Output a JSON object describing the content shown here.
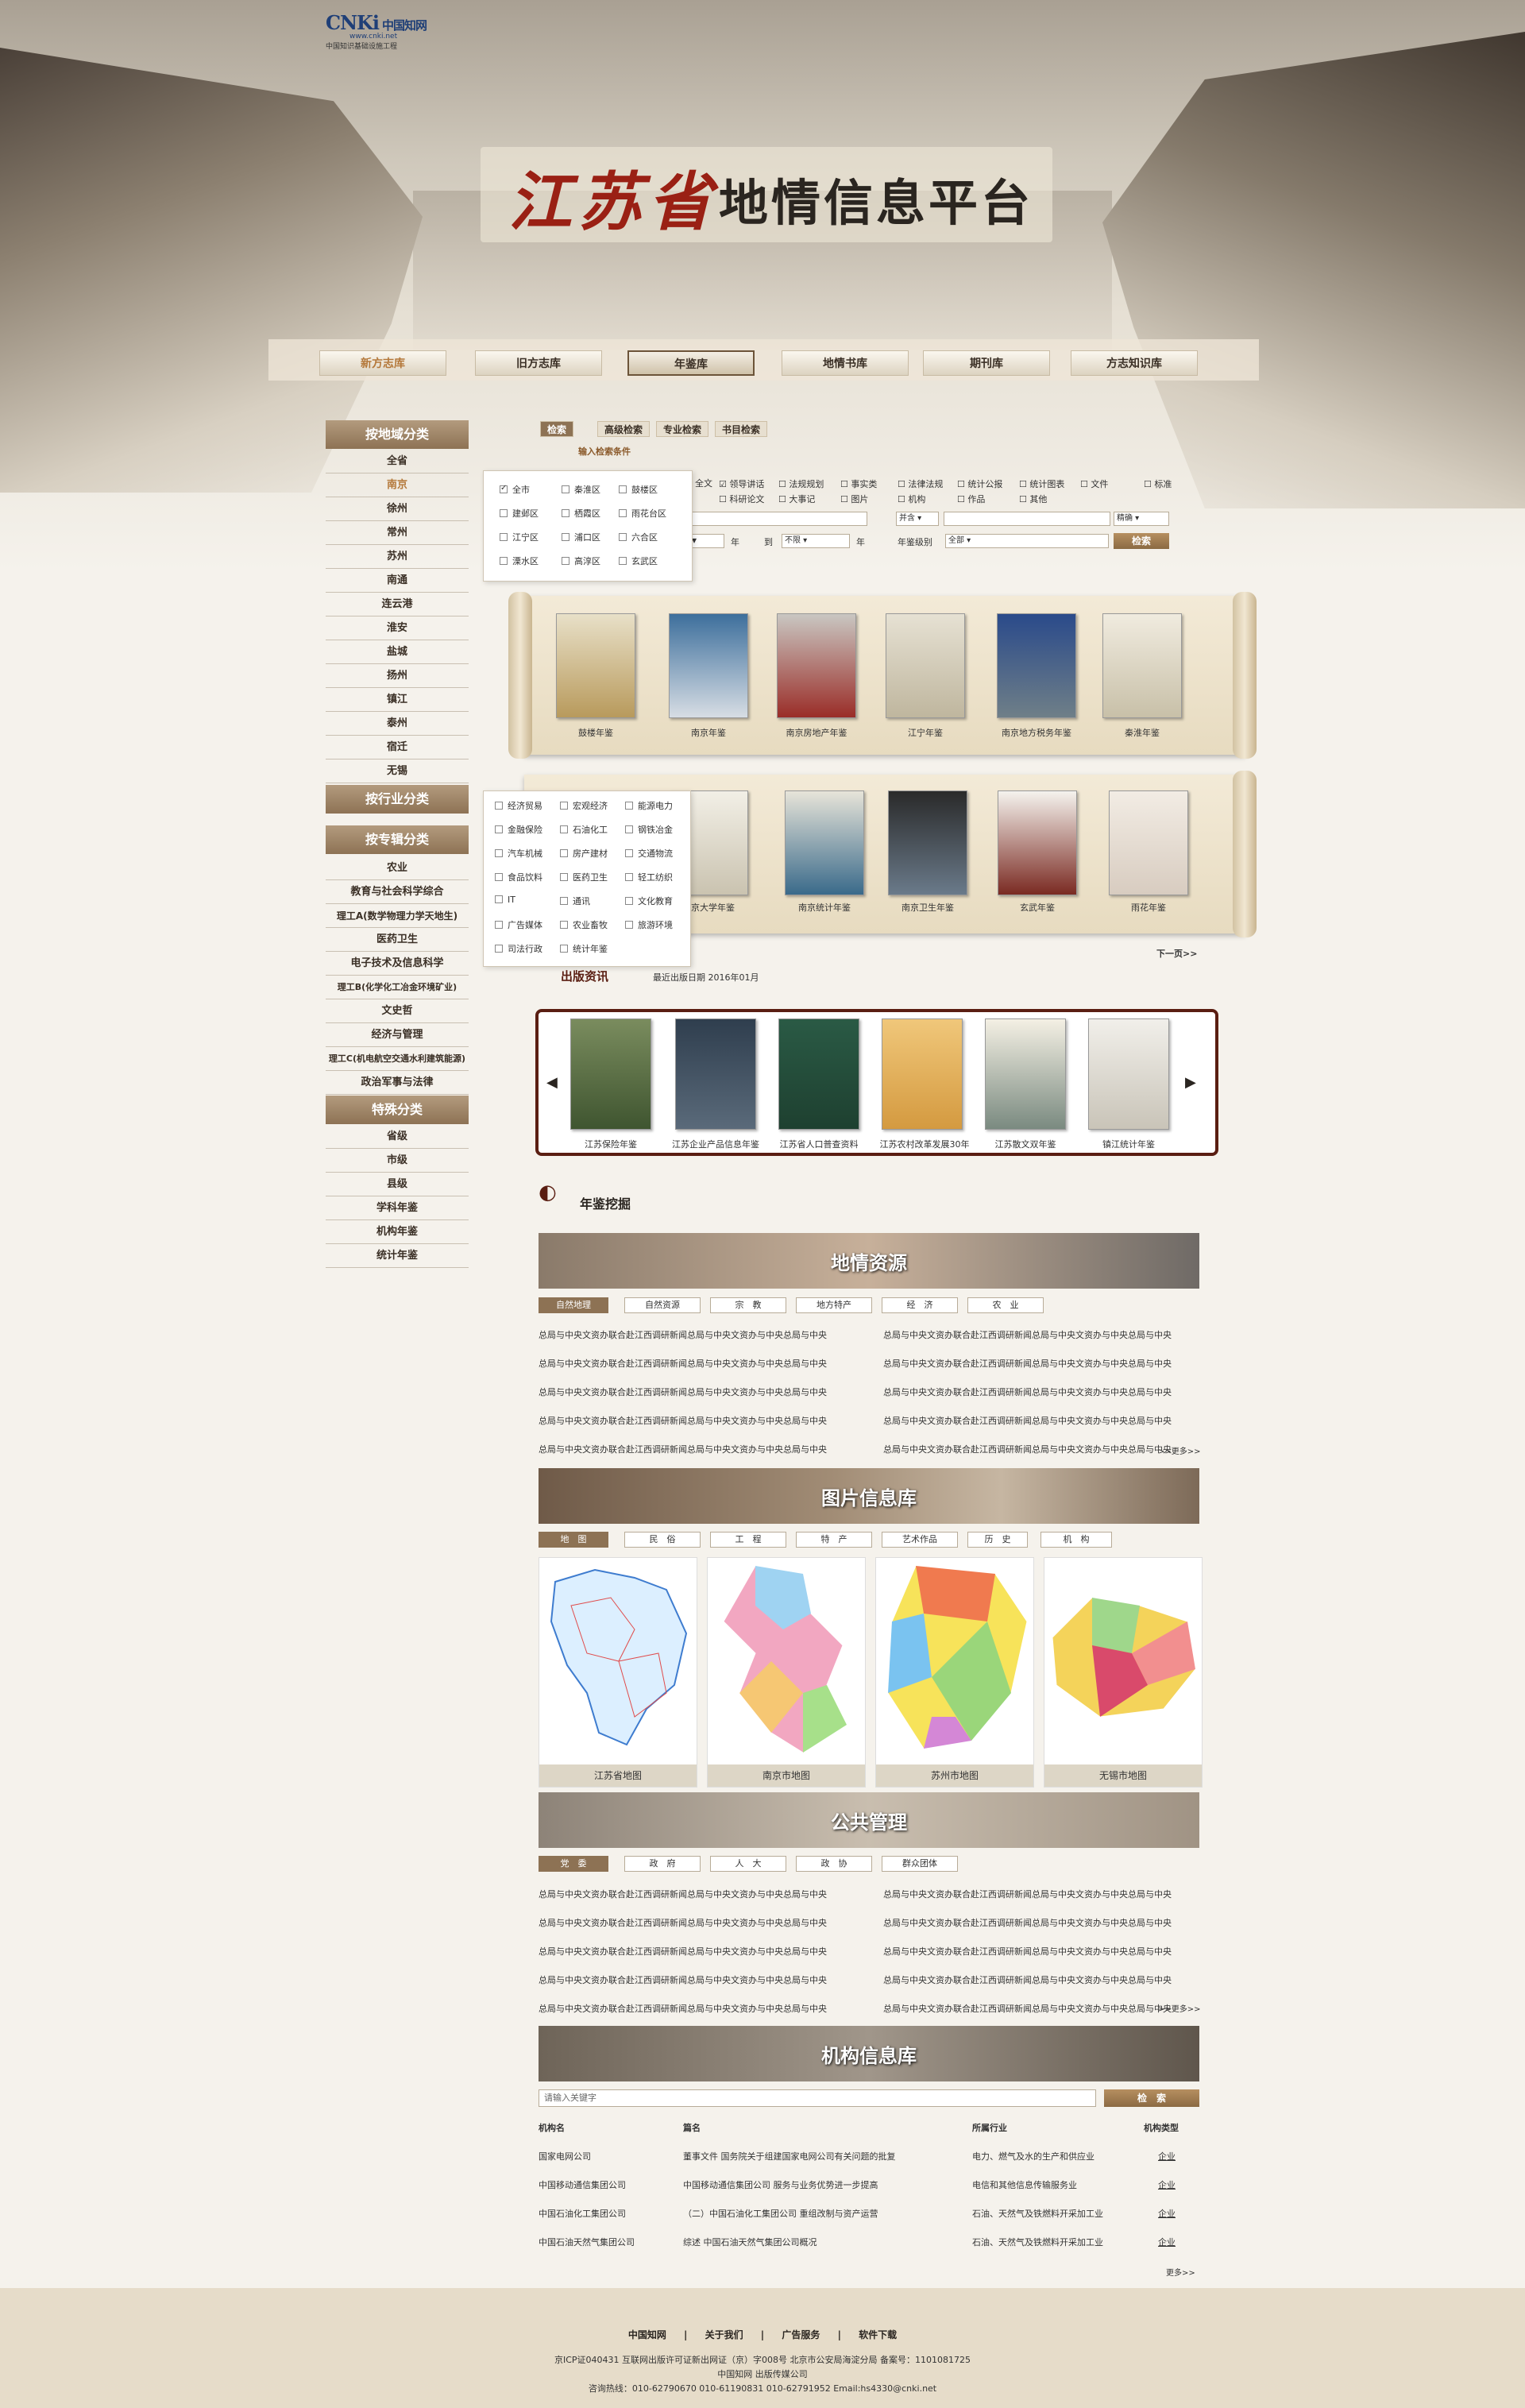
{
  "brand": {
    "logo_text": "CNKi",
    "logo_cn": "中国知网",
    "logo_url": "www.cnki.net",
    "logo_sub": "中国知识基础设施工程"
  },
  "hero": {
    "title_red": "江苏省",
    "title_black": "地情信息平台"
  },
  "nav": [
    "新方志库",
    "旧方志库",
    "年鉴库",
    "地情书库",
    "期刊库",
    "方志知识库"
  ],
  "sidebar": {
    "region_header": "按地域分类",
    "regions": [
      "全省",
      "南京",
      "徐州",
      "常州",
      "苏州",
      "南通",
      "连云港",
      "淮安",
      "盐城",
      "扬州",
      "镇江",
      "泰州",
      "宿迁",
      "无锡"
    ],
    "industry_header": "按行业分类",
    "topic_header": "按专辑分类",
    "topics": [
      "农业",
      "教育与社会科学综合",
      "理工A(数学物理力学天地生)",
      "医药卫生",
      "电子技术及信息科学",
      "理工B(化学化工冶金环境矿业)",
      "文史哲",
      "经济与管理",
      "理工C(机电航空交通水利建筑能源)",
      "政治军事与法律"
    ],
    "special_header": "特殊分类",
    "specials": [
      "省级",
      "市级",
      "县级",
      "学科年鉴",
      "机构年鉴",
      "统计年鉴"
    ]
  },
  "district_dropdown": [
    "全市",
    "秦淮区",
    "鼓楼区",
    "建邺区",
    "栖霞区",
    "雨花台区",
    "江宁区",
    "浦口区",
    "六合区",
    "溧水区",
    "高淳区",
    "玄武区"
  ],
  "industry_dropdown": [
    "经济贸易",
    "宏观经济",
    "能源电力",
    "金融保险",
    "石油化工",
    "钢铁冶金",
    "汽车机械",
    "房产建材",
    "交通物流",
    "食品饮料",
    "医药卫生",
    "轻工纺织",
    "IT",
    "通讯",
    "文化教育",
    "广告媒体",
    "农业畜牧",
    "旅游环境",
    "司法行政",
    "统计年鉴"
  ],
  "search": {
    "tabs": [
      "检索",
      "高级检索",
      "专业检索",
      "书目检索"
    ],
    "condition_label": "输入检索条件",
    "fields": [
      "全文",
      "领导讲话",
      "法规规划",
      "事实类",
      "法律法规",
      "统计公报",
      "统计图表",
      "文件",
      "标准",
      "科研论文",
      "大事记",
      "图片",
      "机构",
      "作品",
      "其他"
    ],
    "op_value": "并含",
    "match_value": "精确",
    "year_from_label": "年",
    "to_label": "到",
    "no_limit": "不限",
    "year_to_label": "年",
    "level_label": "年鉴级别",
    "level_value": "全部",
    "search_button": "检索"
  },
  "books_row1": [
    "鼓楼年鉴",
    "南京年鉴",
    "南京房地产年鉴",
    "江宁年鉴",
    "南京地方税务年鉴",
    "秦淮年鉴"
  ],
  "books_row2": [
    "南京大学年鉴",
    "南京统计年鉴",
    "南京卫生年鉴",
    "玄武年鉴",
    "雨花年鉴"
  ],
  "next_link": "下一页>>",
  "new_pub": {
    "title": "出版资讯",
    "date_label": "最近出版日期 2016年01月",
    "books": [
      "江苏保险年鉴",
      "江苏企业产品信息年鉴",
      "江苏省人口普查资料",
      "江苏农村改革发展30年",
      "江苏散文双年鉴",
      "镇江统计年鉴"
    ]
  },
  "mining": {
    "title": "年鉴挖掘"
  },
  "sec1": {
    "banner": "地情资源",
    "tabs": [
      "自然地理",
      "自然资源",
      "宗　教",
      "地方特产",
      "经　济",
      "农　业"
    ],
    "news": [
      "总局与中央文资办联合赴江西调研新闻总局与中央文资办与中央总局与中央",
      "总局与中央文资办联合赴江西调研新闻总局与中央文资办与中央总局与中央",
      "总局与中央文资办联合赴江西调研新闻总局与中央文资办与中央总局与中央",
      "总局与中央文资办联合赴江西调研新闻总局与中央文资办与中央总局与中央",
      "总局与中央文资办联合赴江西调研新闻总局与中央文资办与中央总局与中央"
    ],
    "more": ">>更多>>"
  },
  "sec2": {
    "banner": "图片信息库",
    "tabs": [
      "地　图",
      "民　俗",
      "工　程",
      "特　产",
      "艺术作品",
      "历　史",
      "机　构"
    ],
    "maps": [
      "江苏省地图",
      "南京市地图",
      "苏州市地图",
      "无锡市地图"
    ]
  },
  "sec3": {
    "banner": "公共管理",
    "tabs": [
      "党　委",
      "政　府",
      "人　大",
      "政　协",
      "群众团体"
    ],
    "more": ">>更多>>"
  },
  "sec4": {
    "banner": "机构信息库",
    "search_placeholder": "请输入关键字",
    "search_button": "检　索",
    "headers": [
      "机构名",
      "篇名",
      "所属行业",
      "机构类型"
    ],
    "rows": [
      [
        "国家电网公司",
        "董事文件  国务院关于组建国家电网公司有关问题的批复",
        "电力、燃气及水的生产和供应业",
        "企业"
      ],
      [
        "中国移动通信集团公司",
        "中国移动通信集团公司  服务与业务优势进一步提高",
        "电信和其他信息传输服务业",
        "企业"
      ],
      [
        "中国石油化工集团公司",
        "（二）中国石油化工集团公司  重组改制与资产运营",
        "石油、天然气及铁燃料开采加工业",
        "企业"
      ],
      [
        "中国石油天然气集团公司",
        "综述  中国石油天然气集团公司概况",
        "石油、天然气及铁燃料开采加工业",
        "企业"
      ]
    ],
    "more": "更多>>"
  },
  "footer": {
    "links": [
      "中国知网",
      "关于我们",
      "广告服务",
      "软件下载"
    ],
    "sep": "|",
    "line1": "京ICP证040431  互联网出版许可证新出网证（京）字008号  北京市公安局海淀分局  备案号：1101081725",
    "line2": "中国知网  出版传媒公司",
    "line3": "咨询热线：010-62790670    010-61190831    010-62791952   Email:hs4330@cnki.net"
  }
}
